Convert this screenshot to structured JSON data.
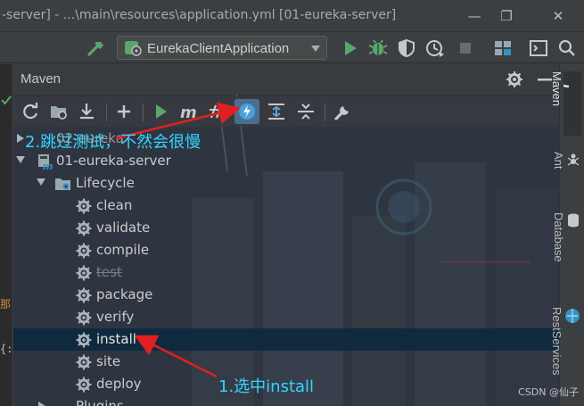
{
  "window": {
    "title": "-server] - ...\\main\\resources\\application.yml [01-eureka-server]",
    "minimize_glyph": "—",
    "restore_glyph": "❐",
    "close_glyph": "✕"
  },
  "toolbar": {
    "run_config": "EurekaClientApplication"
  },
  "left_gutter": {
    "fragments": [
      "那",
      "{:"
    ]
  },
  "maven": {
    "title": "Maven",
    "projects": [
      {
        "label": "02-eureka",
        "collapsed": true
      },
      {
        "label": "01-eureka-server",
        "collapsed": false
      }
    ],
    "lifecycle_label": "Lifecycle",
    "goals": [
      {
        "label": "clean",
        "skipped": false,
        "selected": false
      },
      {
        "label": "validate",
        "skipped": false,
        "selected": false
      },
      {
        "label": "compile",
        "skipped": false,
        "selected": false
      },
      {
        "label": "test",
        "skipped": true,
        "selected": false
      },
      {
        "label": "package",
        "skipped": false,
        "selected": false
      },
      {
        "label": "verify",
        "skipped": false,
        "selected": false
      },
      {
        "label": "install",
        "skipped": false,
        "selected": true
      },
      {
        "label": "site",
        "skipped": false,
        "selected": false
      },
      {
        "label": "deploy",
        "skipped": false,
        "selected": false
      }
    ],
    "plugins_label": "Plugins"
  },
  "annotations": {
    "skip_tests": "2.跳过测试，不然会很慢",
    "select_install": "1.选中install"
  },
  "right_sidebar": {
    "tabs": [
      "Maven",
      "Ant",
      "Database",
      "RestServices"
    ]
  },
  "watermark": "CSDN @仙子",
  "colors": {
    "annotation": "#35d6ff",
    "arrow": "#e02020",
    "selection": "#0d293e",
    "run_green": "#59a869"
  },
  "icons": {
    "refresh": "refresh-icon",
    "generate_sources": "generate-sources-icon",
    "download": "download-icon",
    "add": "add-icon",
    "run": "run-icon",
    "execute_goal": "maven-execute-icon",
    "toggle_offline": "toggle-offline-icon",
    "skip_tests": "skip-tests-icon",
    "show_dependencies": "show-dependencies-icon",
    "collapse_all": "collapse-all-icon",
    "settings": "wrench-icon"
  }
}
